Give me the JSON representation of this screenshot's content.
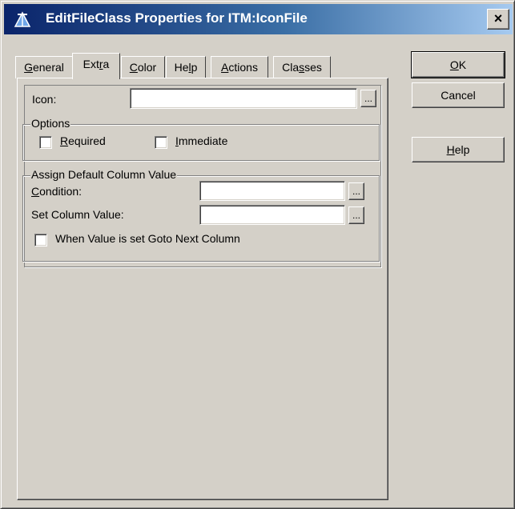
{
  "window": {
    "title": "EditFileClass Properties for ITM:IconFile",
    "close_label": "×"
  },
  "tabs": [
    {
      "label": "General",
      "hotkey": "G",
      "rest": "eneral"
    },
    {
      "label": "Extra",
      "pre": "Ext",
      "hotkey": "r",
      "rest": "a"
    },
    {
      "label": "Color",
      "hotkey": "C",
      "rest": "olor"
    },
    {
      "label": "Help",
      "pre": "He",
      "hotkey": "l",
      "rest": "p"
    },
    {
      "label": "Actions",
      "hotkey": "A",
      "rest": "ctions"
    },
    {
      "label": "Classes",
      "pre": "Cla",
      "hotkey": "s",
      "rest": "ses"
    }
  ],
  "extra": {
    "icon_label": "Icon:",
    "icon_value": "",
    "ellipsis": "...",
    "options_caption": "Options",
    "required": {
      "label": "Required",
      "hotkey": "R",
      "rest": "equired",
      "checked": false
    },
    "immediate": {
      "label": "Immediate",
      "hotkey": "I",
      "rest": "mmediate",
      "checked": false
    },
    "assign_caption": "Assign Default Column Value",
    "condition_label": {
      "hotkey": "C",
      "rest": "ondition:"
    },
    "condition_value": "",
    "set_column_label": "Set Column Value:",
    "set_column_value": "",
    "goto_next": {
      "label": "When Value is set Goto Next Column",
      "checked": false
    }
  },
  "buttons": {
    "ok": {
      "hotkey": "O",
      "rest": "K"
    },
    "cancel": "Cancel",
    "help": {
      "hotkey": "H",
      "rest": "elp"
    }
  }
}
